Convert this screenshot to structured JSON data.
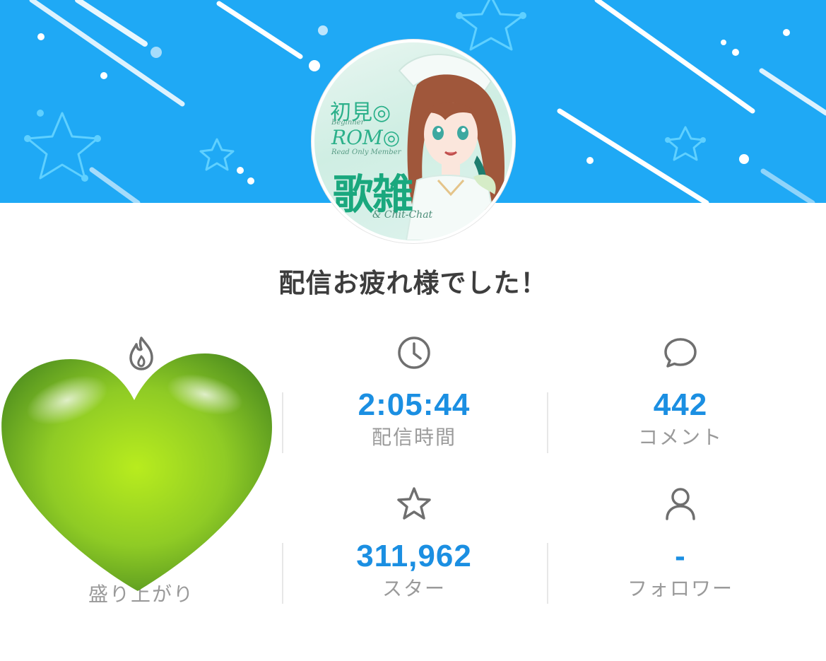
{
  "banner": {
    "background_color": "#1fa9f5"
  },
  "avatar": {
    "text_lines": [
      "初見◎",
      "Beginner",
      "ROM◎",
      "Read Only Member",
      "歌雑",
      "& Chit-Chat"
    ]
  },
  "headline": "配信お疲れ様でした！",
  "stats": {
    "excitement": {
      "icon": "flame-icon",
      "value": "",
      "label": "盛り上がり"
    },
    "duration": {
      "icon": "clock-icon",
      "value": "2:05:44",
      "label": "配信時間"
    },
    "comments": {
      "icon": "speech-bubble-icon",
      "value": "442",
      "label": "コメント"
    },
    "stars": {
      "icon": "star-icon",
      "value": "311,962",
      "label": "スター"
    },
    "followers": {
      "icon": "person-icon",
      "value": "-",
      "label": "フォロワー"
    }
  },
  "overlay": {
    "sticker": "green-heart-emoji"
  },
  "colors": {
    "accent": "#1b8fe2",
    "label": "#9a9a9a",
    "heading": "#3d3d3d"
  }
}
